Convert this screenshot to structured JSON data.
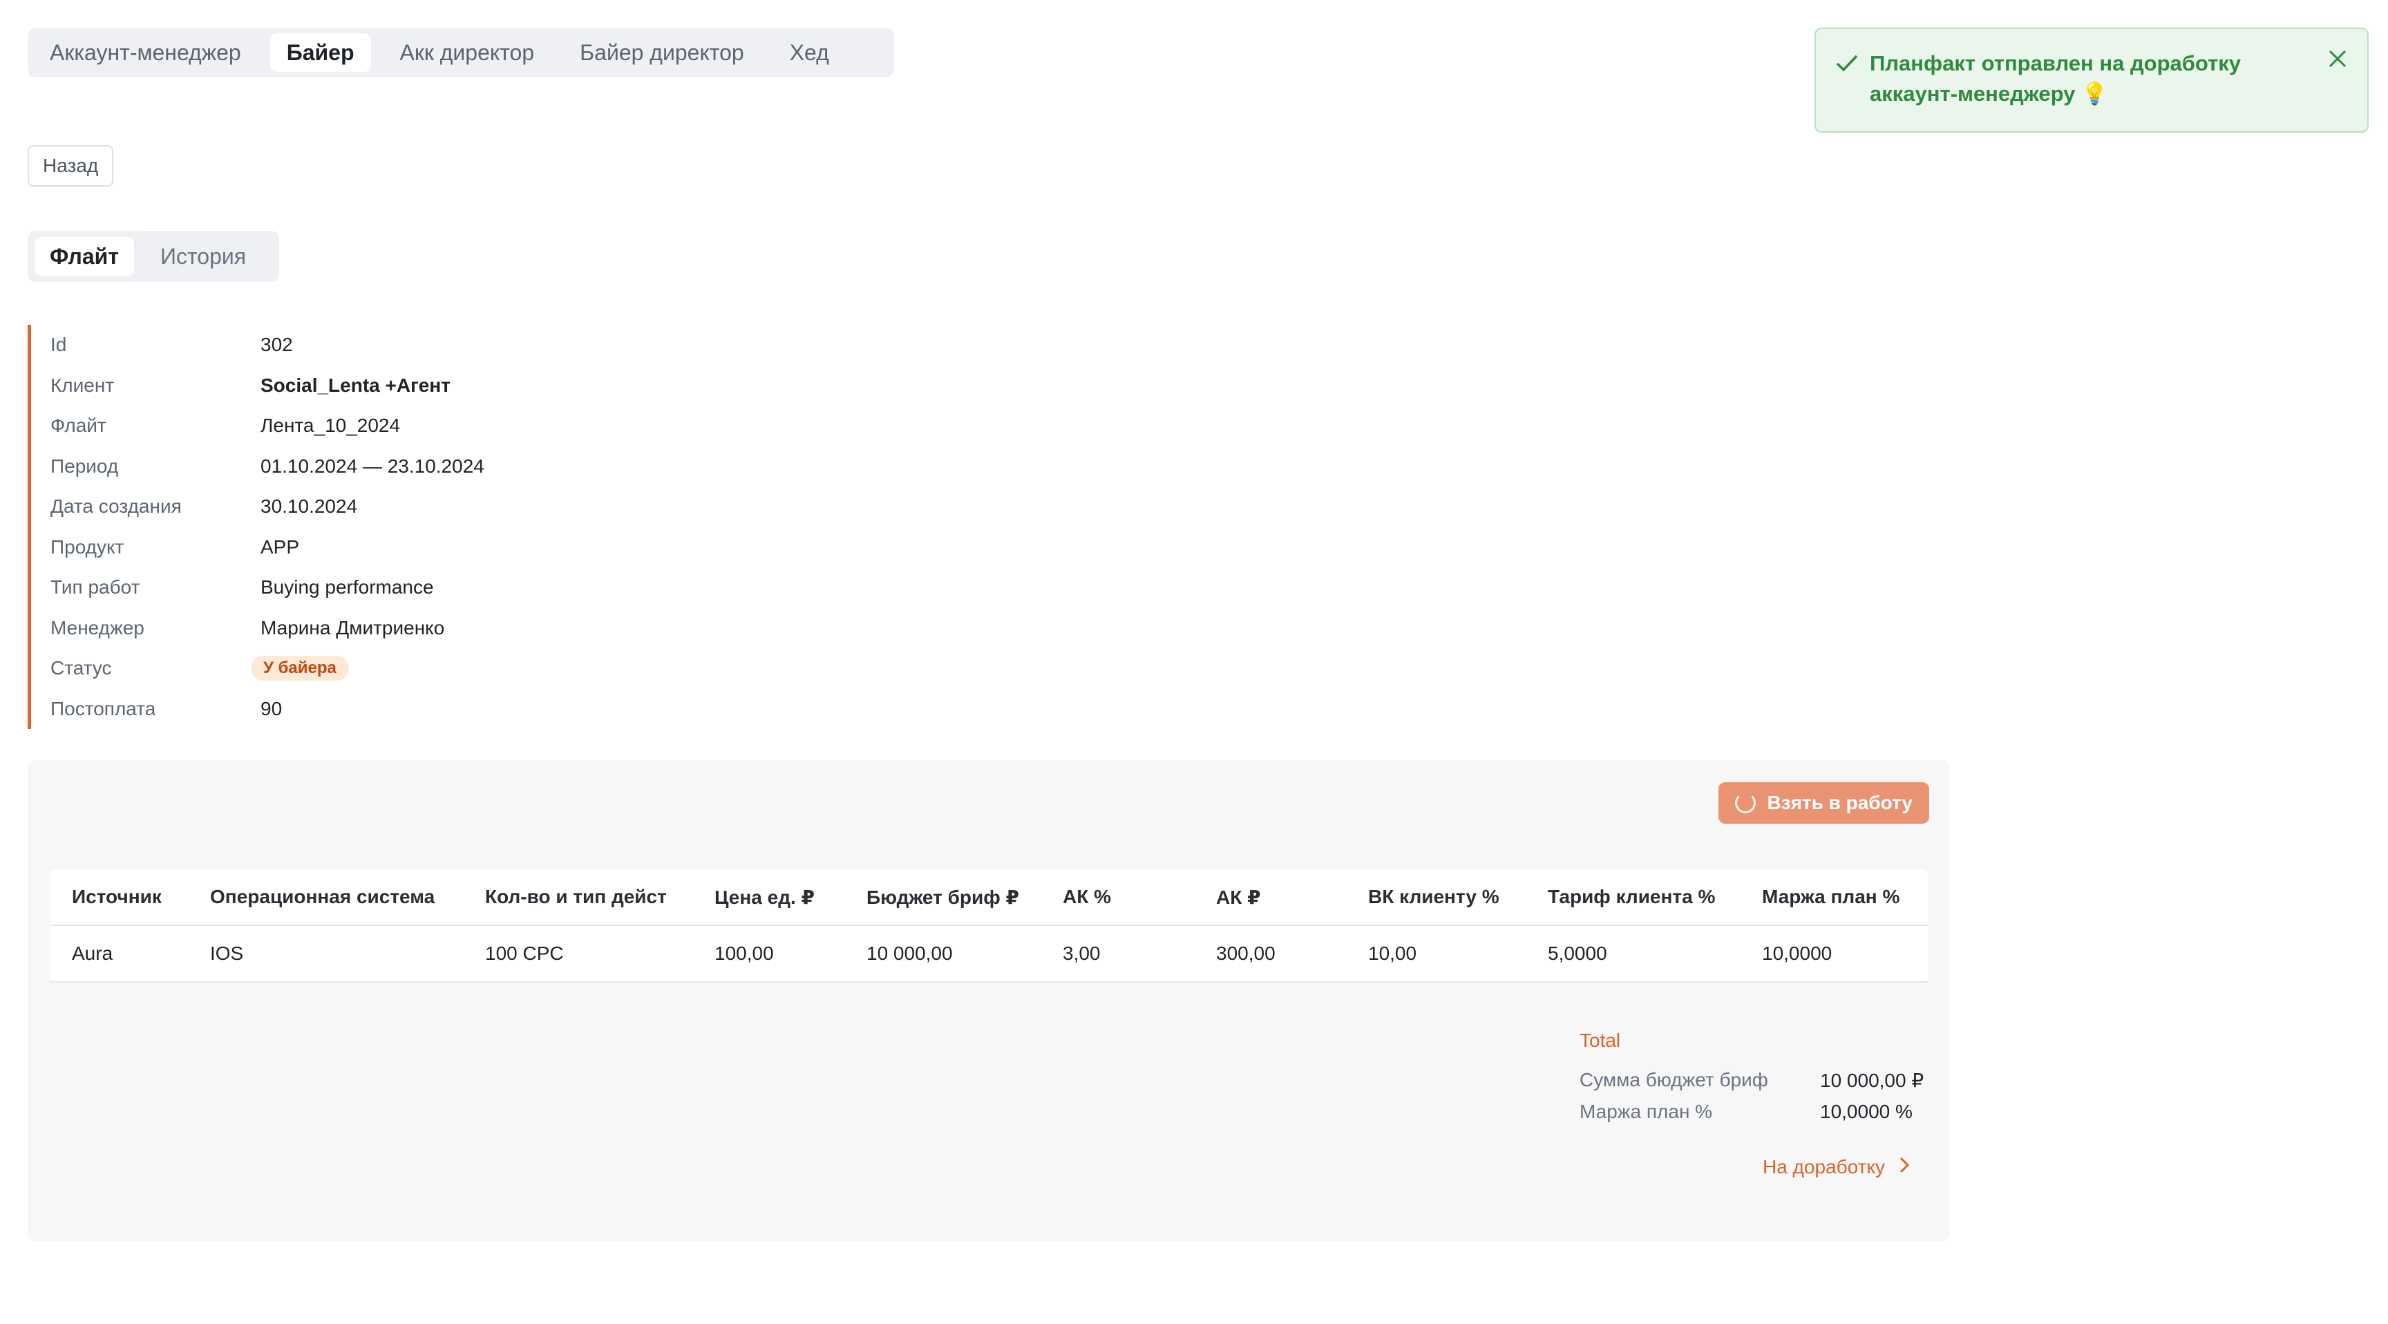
{
  "role_tabs": [
    {
      "label": "Аккаунт-менеджер"
    },
    {
      "label": "Байер"
    },
    {
      "label": "Акк директор"
    },
    {
      "label": "Байер директор"
    },
    {
      "label": "Хед"
    }
  ],
  "back_label": "Назад",
  "flight_tabs": [
    {
      "label": "Флайт"
    },
    {
      "label": "История"
    }
  ],
  "info": {
    "id_label": "Id",
    "id_value": "302",
    "client_label": "Клиент",
    "client_value": "Social_Lenta +Агент",
    "flight_label": "Флайт",
    "flight_value": "Лента_10_2024",
    "period_label": "Период",
    "period_value": "01.10.2024 — 23.10.2024",
    "created_label": "Дата создания",
    "created_value": "30.10.2024",
    "product_label": "Продукт",
    "product_value": "APP",
    "worktype_label": "Тип работ",
    "worktype_value": "Buying performance",
    "manager_label": "Менеджер",
    "manager_value": "Марина Дмитриенко",
    "status_label": "Статус",
    "status_value": "У байера",
    "postpay_label": "Постоплата",
    "postpay_value": "90"
  },
  "take_button_label": "Взять в работу",
  "table": {
    "headers": [
      "Источник",
      "Операционная система",
      "Кол-во и тип дейст",
      "Цена ед. ₽",
      "Бюджет бриф ₽",
      "АК %",
      "АК ₽",
      "ВК клиенту %",
      "Тариф клиента %",
      "Маржа план %"
    ],
    "rows": [
      [
        "Aura",
        "IOS",
        "100 CPC",
        "100,00",
        "10 000,00",
        "3,00",
        "300,00",
        "10,00",
        "5,0000",
        "10,0000"
      ]
    ]
  },
  "totals": {
    "title": "Total",
    "budget_label": "Сумма бюджет бриф",
    "budget_value": "10 000,00 ₽",
    "margin_label": "Маржа план %",
    "margin_value": "10,0000 %"
  },
  "rework_label": "На доработку",
  "toast": {
    "line1": "Планфакт отправлен на доработку",
    "line2": "аккаунт-менеджеру 💡"
  },
  "colors": {
    "accent": "#e0642c",
    "success": "#2f8a3f",
    "button": "#e99373"
  }
}
